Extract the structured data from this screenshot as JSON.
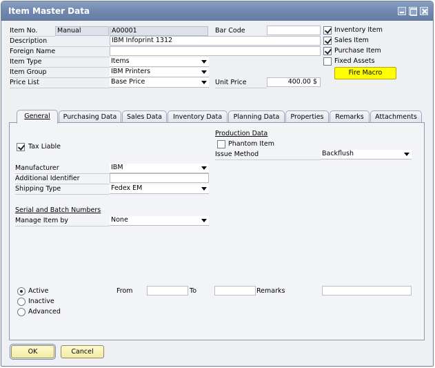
{
  "window": {
    "title": "Item Master Data"
  },
  "header": {
    "item_no_label": "Item No.",
    "item_no_series": "Manual",
    "item_no_value": "A00001",
    "bar_code_label": "Bar Code",
    "bar_code_value": "",
    "description_label": "Description",
    "description_value": "IBM Infoprint 1312",
    "foreign_name_label": "Foreign Name",
    "foreign_name_value": "",
    "item_type_label": "Item Type",
    "item_type_value": "Items",
    "item_group_label": "Item Group",
    "item_group_value": "IBM Printers",
    "price_list_label": "Price List",
    "price_list_value": "Base Price",
    "unit_price_label": "Unit Price",
    "unit_price_value": "400.00 $"
  },
  "flags": [
    {
      "label": "Inventory Item",
      "checked": true
    },
    {
      "label": "Sales Item",
      "checked": true
    },
    {
      "label": "Purchase Item",
      "checked": true
    },
    {
      "label": "Fixed Assets",
      "checked": false
    }
  ],
  "fire_macro_label": "Fire Macro",
  "tabs": [
    {
      "label": "General",
      "active": true
    },
    {
      "label": "Purchasing Data",
      "active": false
    },
    {
      "label": "Sales Data",
      "active": false
    },
    {
      "label": "Inventory Data",
      "active": false
    },
    {
      "label": "Planning Data",
      "active": false
    },
    {
      "label": "Properties",
      "active": false
    },
    {
      "label": "Remarks",
      "active": false
    },
    {
      "label": "Attachments",
      "active": false
    }
  ],
  "general": {
    "tax_liable_label": "Tax Liable",
    "tax_liable_checked": true,
    "production_data_title": "Production Data",
    "phantom_item_label": "Phantom Item",
    "phantom_item_checked": false,
    "issue_method_label": "Issue Method",
    "issue_method_value": "Backflush",
    "manufacturer_label": "Manufacturer",
    "manufacturer_value": "IBM",
    "additional_identifier_label": "Additional Identifier",
    "additional_identifier_value": "",
    "shipping_type_label": "Shipping Type",
    "shipping_type_value": "Fedex EM",
    "serial_batch_title": "Serial and Batch Numbers",
    "manage_item_by_label": "Manage Item by",
    "manage_item_by_value": "None",
    "status_options": [
      {
        "label": "Active",
        "selected": true
      },
      {
        "label": "Inactive",
        "selected": false
      },
      {
        "label": "Advanced",
        "selected": false
      }
    ],
    "from_label": "From",
    "from_value": "",
    "to_label": "To",
    "to_value": "",
    "remarks_label": "Remarks",
    "remarks_value": ""
  },
  "buttons": {
    "ok_label": "OK",
    "cancel_label": "Cancel"
  },
  "colors": {
    "title_bar": "#7088ad",
    "fire_macro": "#ffff00",
    "button_face": "#f2e9a1",
    "panel_bg": "#f3f4f8"
  }
}
